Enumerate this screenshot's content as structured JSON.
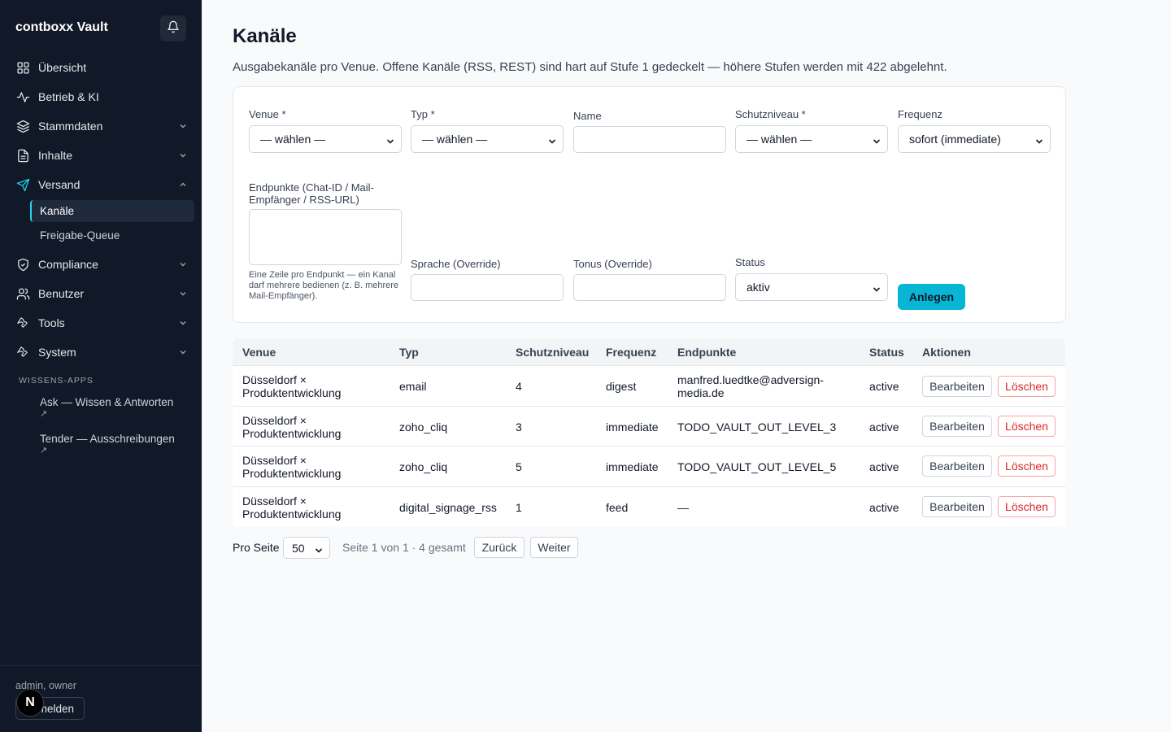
{
  "app": {
    "brand": "contboxx Vault",
    "icons": {
      "bell": "bell-icon"
    }
  },
  "sidebar": {
    "items": [
      {
        "label": "Übersicht",
        "icon": "grid-icon",
        "chevron": ""
      },
      {
        "label": "Betrieb & KI",
        "icon": "activity-icon",
        "chevron": ""
      },
      {
        "label": "Stammdaten",
        "icon": "layers-icon",
        "chevron": "down"
      },
      {
        "label": "Inhalte",
        "icon": "document-icon",
        "chevron": "down"
      },
      {
        "label": "Versand",
        "icon": "send-icon",
        "chevron": "up"
      },
      {
        "label": "Compliance",
        "icon": "shield-icon",
        "chevron": "down"
      },
      {
        "label": "Benutzer",
        "icon": "users-icon",
        "chevron": "down"
      },
      {
        "label": "Tools",
        "icon": "wrench-icon",
        "chevron": "down"
      },
      {
        "label": "System",
        "icon": "wrench-icon",
        "chevron": "down"
      }
    ],
    "versand_subitems": [
      "Kanäle",
      "Freigabe-Queue"
    ],
    "section_label": "WISSENS-APPS",
    "apps": [
      {
        "label": "Ask — Wissen & Antworten",
        "arrow": "↗"
      },
      {
        "label": "Tender — Ausschreibungen",
        "arrow": "↗"
      }
    ],
    "footer": {
      "user": "admin, owner",
      "logout_label": "Abmelden",
      "avatar_letter": "N"
    }
  },
  "page": {
    "title": "Kanäle",
    "description": "Ausgabekanäle pro Venue. Offene Kanäle (RSS, REST) sind hart auf Stufe 1 gedeckelt — höhere Stufen werden mit 422 abgelehnt."
  },
  "form": {
    "venue": {
      "label": "Venue *",
      "value": "— wählen —"
    },
    "typ": {
      "label": "Typ *",
      "value": "— wählen —"
    },
    "name": {
      "label": "Name",
      "value": ""
    },
    "schutzniveau": {
      "label": "Schutzniveau *",
      "value": "— wählen —"
    },
    "frequenz": {
      "label": "Frequenz",
      "value": "sofort (immediate)"
    },
    "endpunkte": {
      "label": "Endpunkte (Chat-ID / Mail-Empfänger / RSS-URL)",
      "value": "",
      "hint": "Eine Zeile pro Endpunkt — ein Kanal darf mehrere bedienen (z. B. mehrere Mail-Empfänger)."
    },
    "sprache": {
      "label": "Sprache (Override)",
      "value": ""
    },
    "tonus": {
      "label": "Tonus (Override)",
      "value": ""
    },
    "status": {
      "label": "Status",
      "value": "aktiv"
    },
    "submit_label": "Anlegen"
  },
  "table": {
    "columns": [
      "Venue",
      "Typ",
      "Schutzniveau",
      "Frequenz",
      "Endpunkte",
      "Status",
      "Aktionen"
    ],
    "rows": [
      {
        "venue": [
          "Düsseldorf ×",
          "Produktentwicklung"
        ],
        "typ": "email",
        "schutzniveau": "4",
        "frequenz": "digest",
        "endpunkte": [
          "manfred.luedtke@adversign-",
          "media.de"
        ],
        "status": "active"
      },
      {
        "venue": [
          "Düsseldorf ×",
          "Produktentwicklung"
        ],
        "typ": "zoho_cliq",
        "schutzniveau": "3",
        "frequenz": "immediate",
        "endpunkte": [
          "TODO_VAULT_OUT_LEVEL_3"
        ],
        "status": "active"
      },
      {
        "venue": [
          "Düsseldorf ×",
          "Produktentwicklung"
        ],
        "typ": "zoho_cliq",
        "schutzniveau": "5",
        "frequenz": "immediate",
        "endpunkte": [
          "TODO_VAULT_OUT_LEVEL_5"
        ],
        "status": "active"
      },
      {
        "venue": [
          "Düsseldorf ×",
          "Produktentwicklung"
        ],
        "typ": "digital_signage_rss",
        "schutzniveau": "1",
        "frequenz": "feed",
        "endpunkte": [
          "—"
        ],
        "status": "active"
      }
    ],
    "edit_label": "Bearbeiten",
    "delete_label": "Löschen"
  },
  "pagination": {
    "per_page_label": "Pro Seite",
    "per_page_value": "50",
    "info": "Seite 1 von 1 · 4 gesamt",
    "prev_label": "Zurück",
    "next_label": "Weiter"
  },
  "colors": {
    "sidebar_bg": "#111827",
    "accent": "#06b6d4",
    "danger": "#dc2626"
  }
}
